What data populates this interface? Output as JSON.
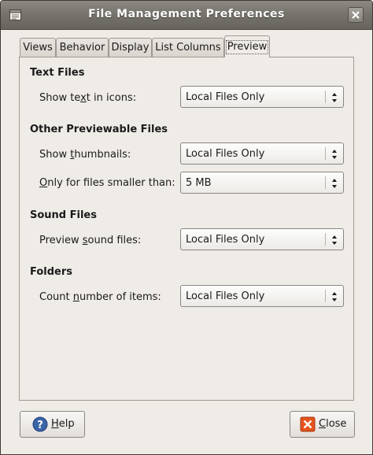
{
  "window": {
    "title": "File Management Preferences"
  },
  "tabs": [
    {
      "label": "Views"
    },
    {
      "label": "Behavior"
    },
    {
      "label": "Display"
    },
    {
      "label": "List Columns"
    },
    {
      "label": "Preview",
      "active": true
    }
  ],
  "sections": {
    "text_files": {
      "title": "Text Files",
      "show_text": {
        "label_pre": "Show te",
        "mnemonic": "x",
        "label_post": "t in icons:",
        "value": "Local Files Only"
      }
    },
    "other_files": {
      "title": "Other Previewable Files",
      "thumbnails": {
        "label_pre": "Show ",
        "mnemonic": "t",
        "label_post": "humbnails:",
        "value": "Local Files Only"
      },
      "size_limit": {
        "label_pre": "",
        "mnemonic": "O",
        "label_post": "nly for files smaller than:",
        "value": "5 MB"
      }
    },
    "sound_files": {
      "title": "Sound Files",
      "preview_sound": {
        "label_pre": "Preview ",
        "mnemonic": "s",
        "label_post": "ound files:",
        "value": "Local Files Only"
      }
    },
    "folders": {
      "title": "Folders",
      "count_items": {
        "label_pre": "Count ",
        "mnemonic": "n",
        "label_post": "umber of items:",
        "value": "Local Files Only"
      }
    }
  },
  "buttons": {
    "help": {
      "mnemonic": "H",
      "label_post": "elp",
      "icon": "help-icon"
    },
    "close": {
      "mnemonic": "C",
      "label_post": "lose",
      "icon": "close-icon"
    }
  },
  "colors": {
    "titlebar": "#77736d",
    "window_bg": "#efebe7",
    "help_icon": "#3a64a6",
    "close_icon": "#e4541d"
  }
}
